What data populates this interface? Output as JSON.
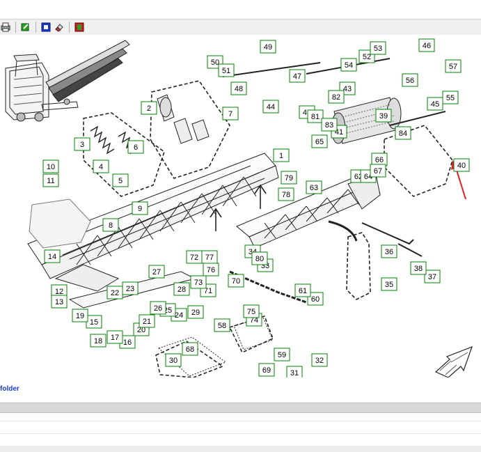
{
  "toolbar": {
    "buttons": [
      {
        "icon": "print-icon"
      },
      {
        "icon": "export-icon"
      },
      {
        "icon": "select-icon"
      },
      {
        "icon": "erase-icon"
      },
      {
        "icon": "parts-list-icon"
      }
    ]
  },
  "diagram": {
    "callouts": [
      "1",
      "2",
      "3",
      "4",
      "5",
      "6",
      "7",
      "8",
      "9",
      "10",
      "11",
      "12",
      "13",
      "14",
      "15",
      "16",
      "17",
      "18",
      "19",
      "20",
      "21",
      "22",
      "23",
      "24",
      "25",
      "26",
      "27",
      "28",
      "29",
      "30",
      "31",
      "32",
      "33",
      "34",
      "35",
      "36",
      "37",
      "38",
      "39",
      "40",
      "41",
      "42",
      "43",
      "44",
      "45",
      "46",
      "47",
      "48",
      "49",
      "50",
      "51",
      "52",
      "53",
      "54",
      "55",
      "56",
      "57",
      "58",
      "59",
      "60",
      "61",
      "62",
      "63",
      "64",
      "65",
      "66",
      "67",
      "68",
      "69",
      "70",
      "71",
      "72",
      "73",
      "74",
      "75",
      "76",
      "77",
      "78",
      "79",
      "80",
      "81",
      "82",
      "83",
      "84"
    ],
    "highlight_color": "#e02020",
    "callout_border_color": "#008000"
  },
  "footer": {
    "folder_label": "folder"
  }
}
